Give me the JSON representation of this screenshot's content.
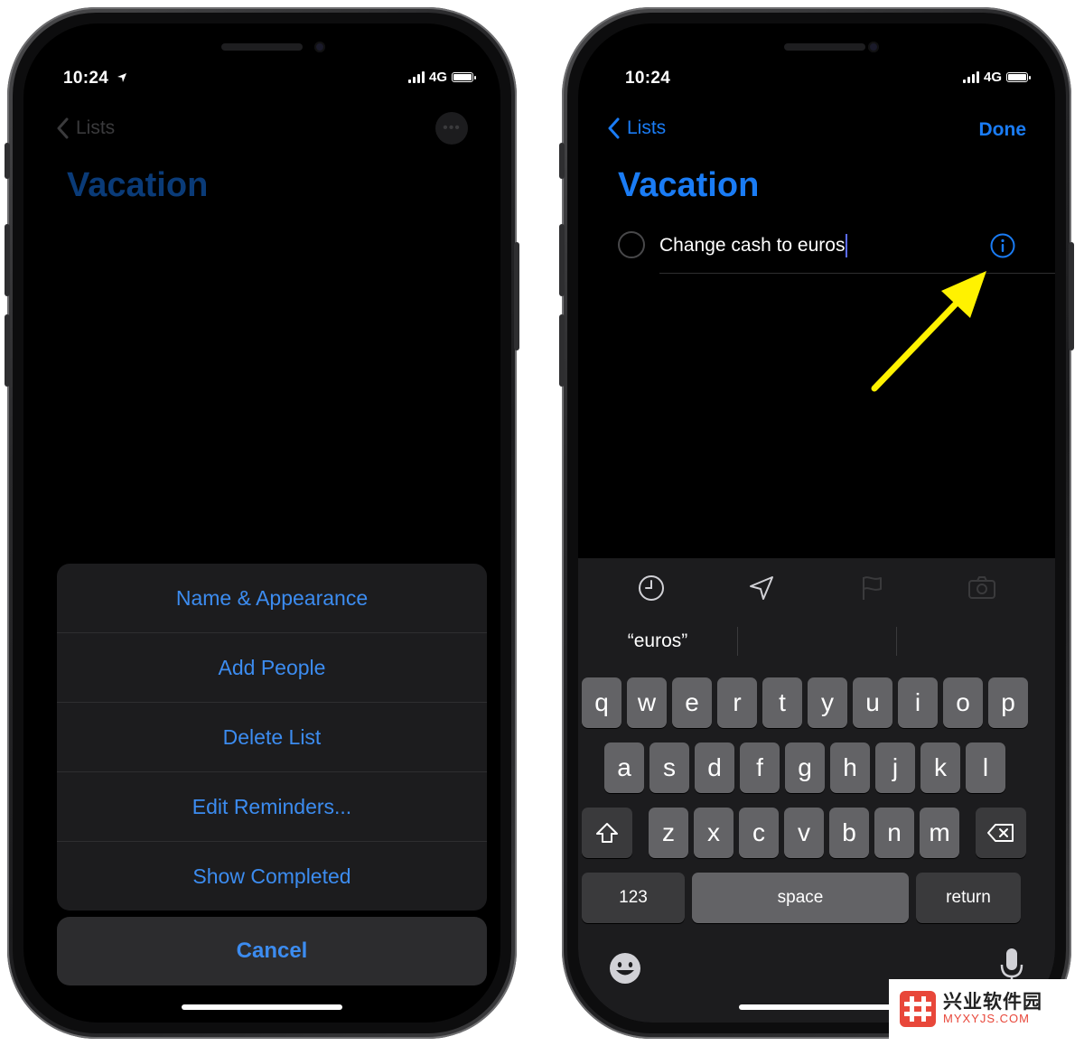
{
  "status": {
    "time": "10:24",
    "network": "4G"
  },
  "left_screen": {
    "back_label": "Lists",
    "more_label": "•••",
    "title": "Vacation",
    "action_sheet": {
      "items": [
        "Name & Appearance",
        "Add People",
        "Delete List",
        "Edit Reminders...",
        "Show Completed"
      ],
      "cancel_label": "Cancel"
    }
  },
  "right_screen": {
    "back_label": "Lists",
    "done_label": "Done",
    "title": "Vacation",
    "reminder": {
      "text": "Change cash to euros",
      "completed": false
    },
    "keyboard": {
      "suggestions": [
        "“euros”",
        "",
        ""
      ],
      "row1": [
        "q",
        "w",
        "e",
        "r",
        "t",
        "y",
        "u",
        "i",
        "o",
        "p"
      ],
      "row2": [
        "a",
        "s",
        "d",
        "f",
        "g",
        "h",
        "j",
        "k",
        "l"
      ],
      "row3": [
        "z",
        "x",
        "c",
        "v",
        "b",
        "n",
        "m"
      ],
      "numbers_label": "123",
      "space_label": "space",
      "return_label": "return"
    }
  },
  "colors": {
    "accent": "#1a7cf5",
    "annotation_arrow": "#fff200"
  },
  "watermark": {
    "title": "兴业软件园",
    "url": "MYXYJS.COM"
  }
}
